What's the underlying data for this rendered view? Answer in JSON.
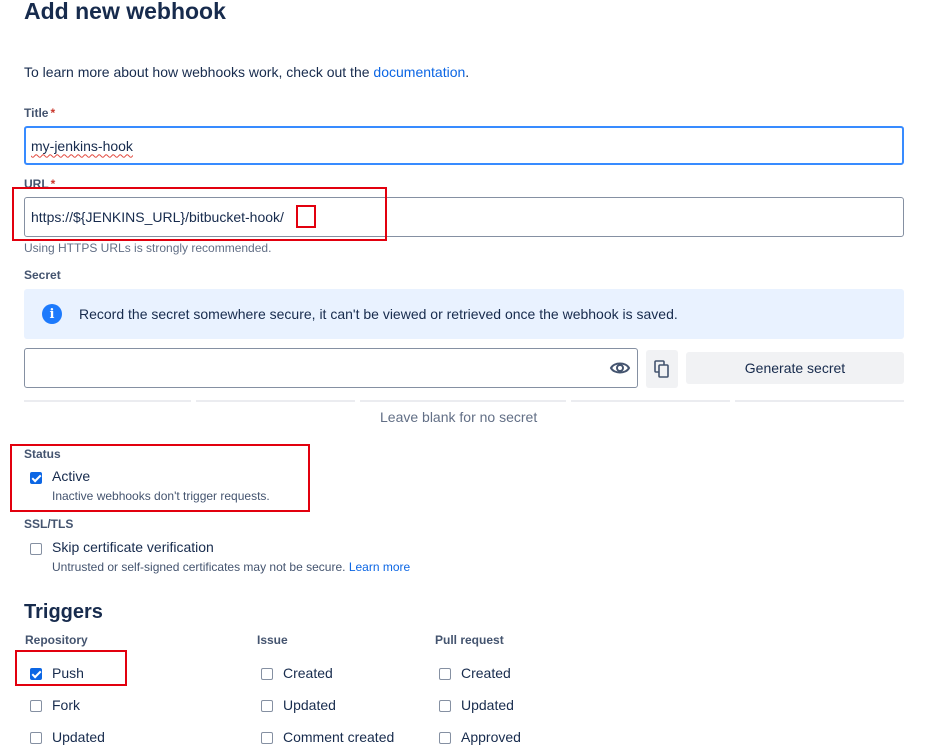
{
  "page": {
    "title": "Add new webhook",
    "intro_text": "To learn more about how webhooks work, check out the ",
    "intro_link": "documentation",
    "intro_suffix": "."
  },
  "form": {
    "title_label": "Title",
    "title_value": "my-jenkins-hook",
    "url_label": "URL",
    "url_value": "https://${JENKINS_URL}/bitbucket-hook/",
    "url_help": "Using HTTPS URLs is strongly recommended.",
    "required_mark": "*",
    "secret_label": "Secret",
    "secret_info": "Record the secret somewhere secure, it can't be viewed or retrieved once the webhook is saved.",
    "secret_value": "",
    "generate_secret_label": "Generate secret",
    "secret_help": "Leave blank for no secret",
    "status_label": "Status",
    "active_label": "Active",
    "active_checked": true,
    "active_help": "Inactive webhooks don't trigger requests.",
    "ssl_label": "SSL/TLS",
    "skip_cert_label": "Skip certificate verification",
    "skip_cert_checked": false,
    "skip_cert_help": "Untrusted or self-signed certificates may not be secure. ",
    "learn_more": "Learn more"
  },
  "triggers": {
    "heading": "Triggers",
    "repository": {
      "label": "Repository",
      "items": [
        {
          "label": "Push",
          "checked": true
        },
        {
          "label": "Fork",
          "checked": false
        },
        {
          "label": "Updated",
          "checked": false
        }
      ]
    },
    "issue": {
      "label": "Issue",
      "items": [
        {
          "label": "Created",
          "checked": false
        },
        {
          "label": "Updated",
          "checked": false
        },
        {
          "label": "Comment created",
          "checked": false
        }
      ]
    },
    "pull_request": {
      "label": "Pull request",
      "items": [
        {
          "label": "Created",
          "checked": false
        },
        {
          "label": "Updated",
          "checked": false
        },
        {
          "label": "Approved",
          "checked": false
        }
      ]
    }
  },
  "colors": {
    "accent": "#0c66e4",
    "annotation": "#e2000e",
    "info_bg": "#e9f2ff"
  }
}
